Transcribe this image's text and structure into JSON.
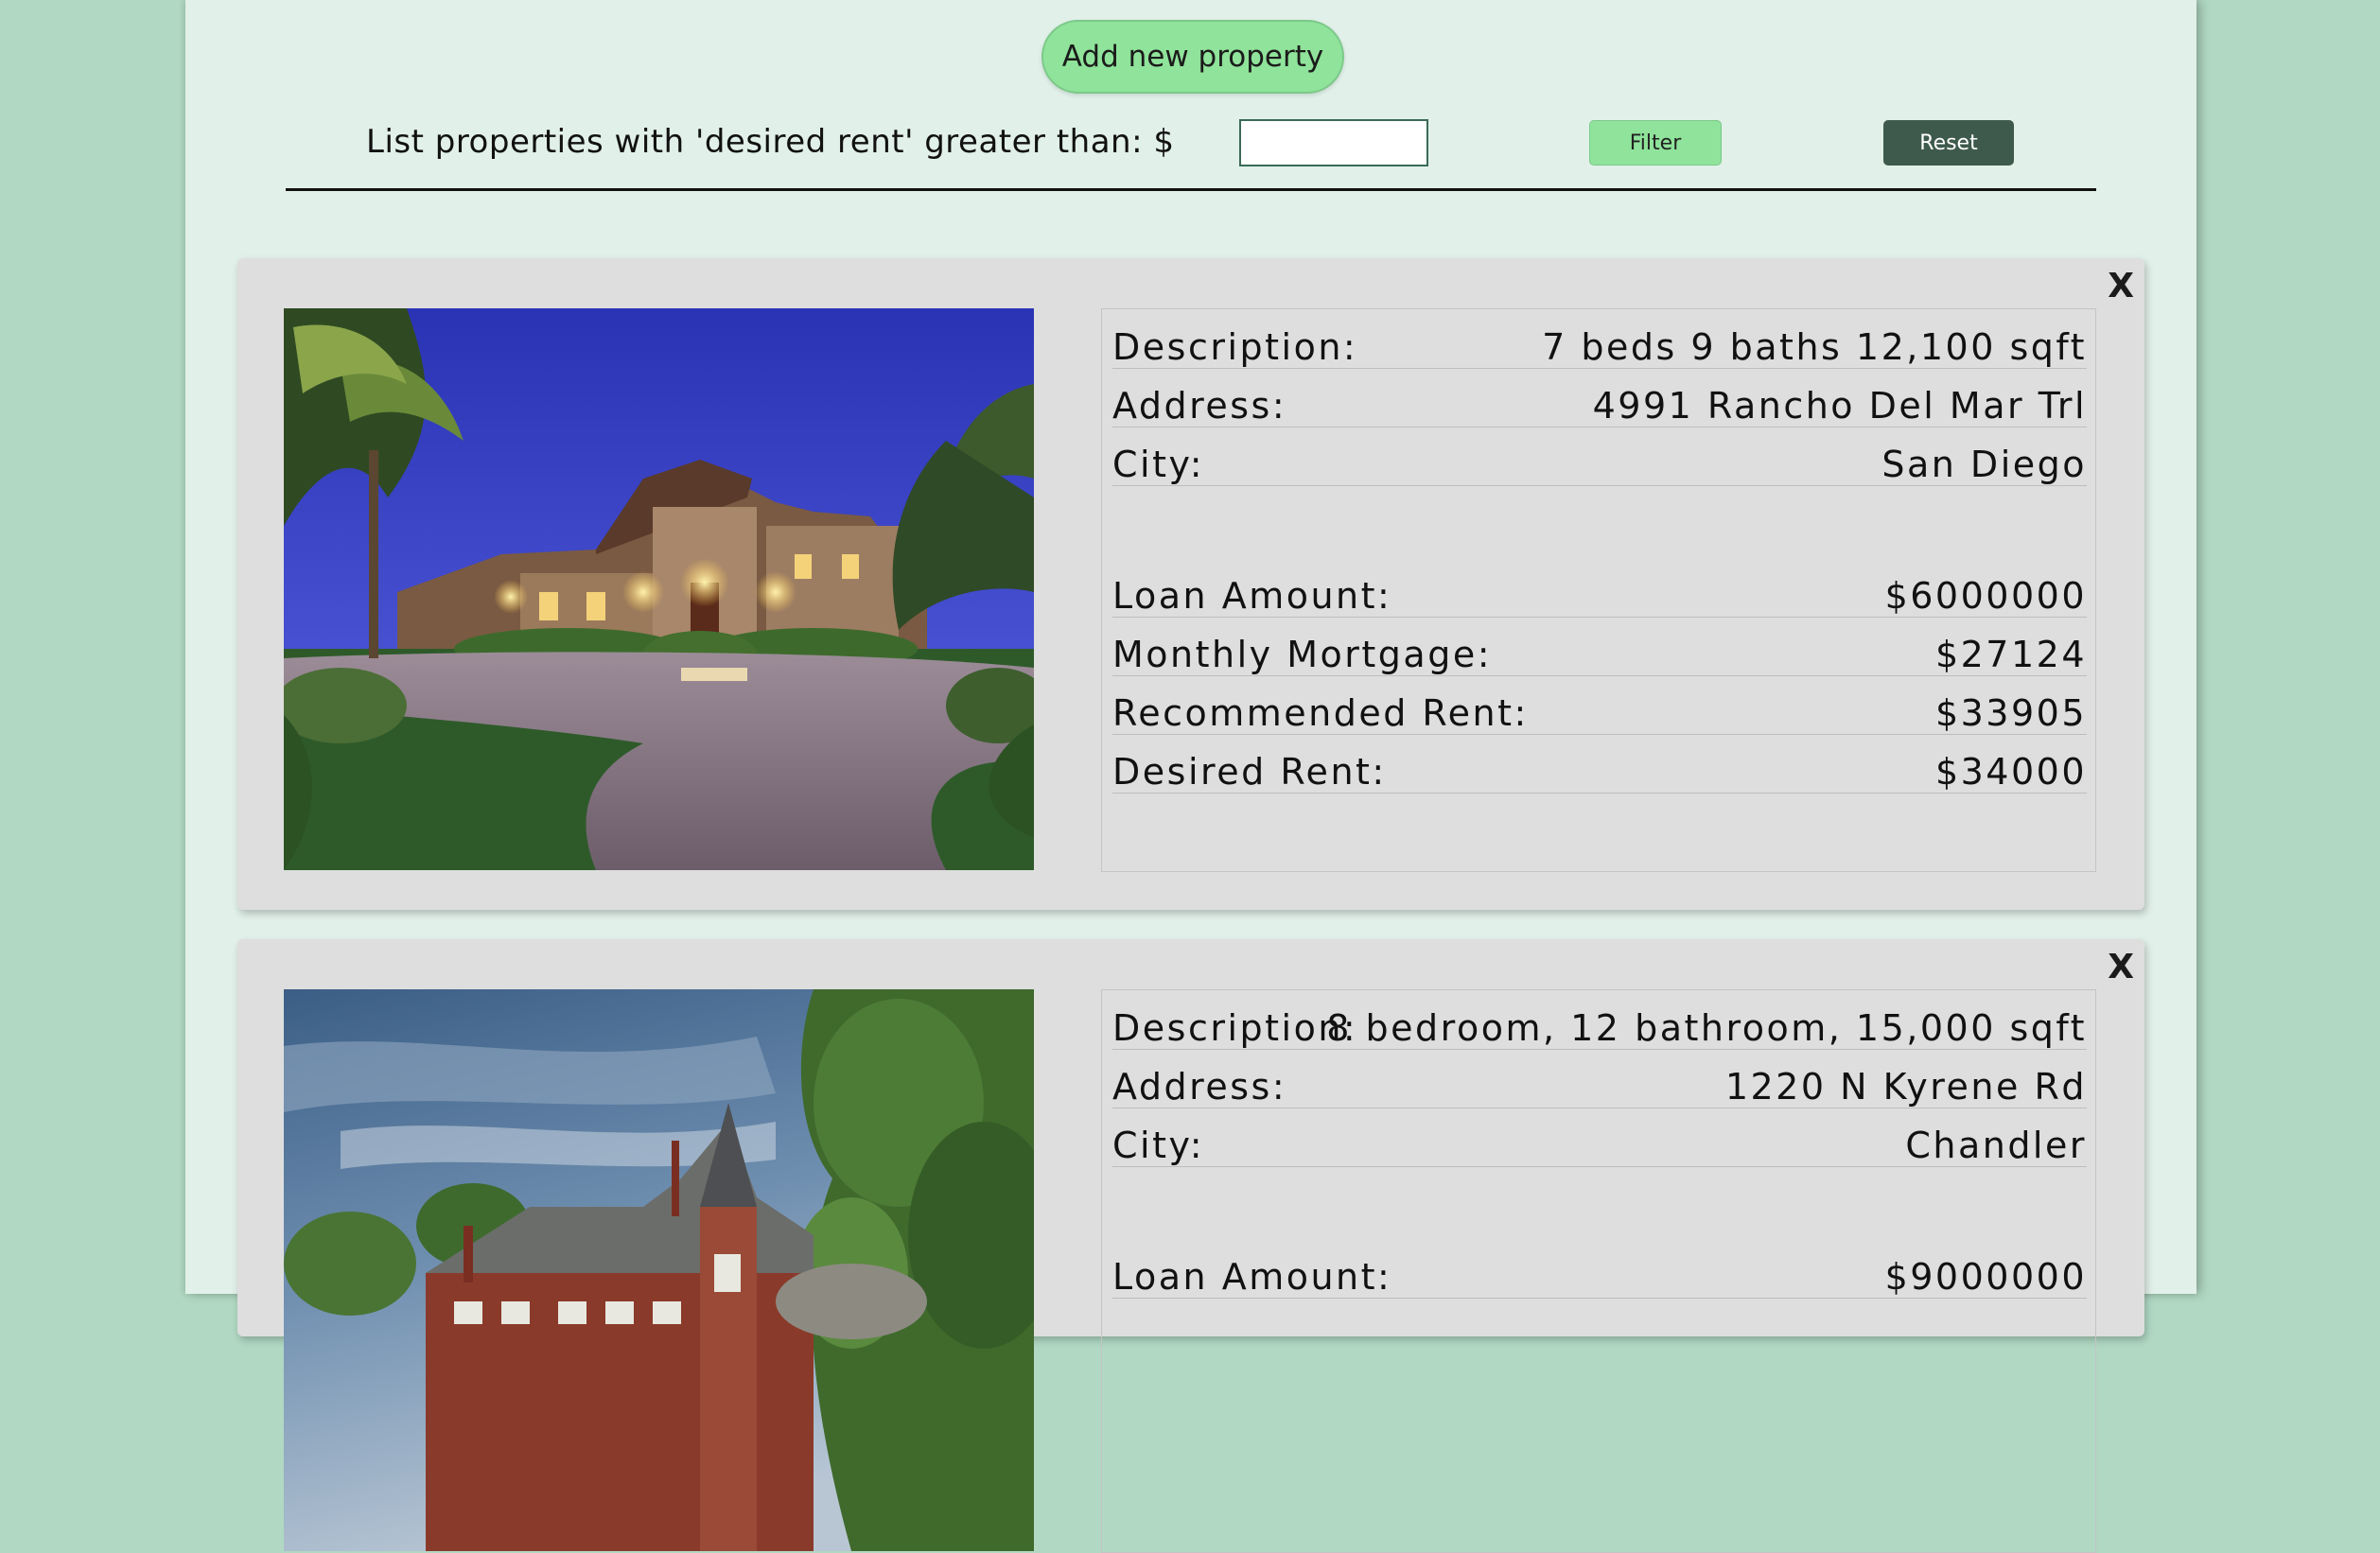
{
  "toolbar": {
    "add_label": "Add new property",
    "filter_label": "List properties with 'desired rent' greater than: $",
    "filter_value": "",
    "filter_button": "Filter",
    "reset_button": "Reset"
  },
  "properties": [
    {
      "close": "X",
      "photo_icon": "house-photo",
      "description_label": "Description:",
      "description": "7 beds 9 baths 12,100 sqft",
      "address_label": "Address:",
      "address": "4991 Rancho Del Mar Trl",
      "city_label": "City:",
      "city": "San Diego",
      "loan_label": "Loan Amount:",
      "loan": "$6000000",
      "mortgage_label": "Monthly Mortgage:",
      "mortgage": "$27124",
      "recommended_label": "Recommended Rent:",
      "recommended": "$33905",
      "desired_label": "Desired Rent:",
      "desired": "$34000"
    },
    {
      "close": "X",
      "photo_icon": "mansion-photo",
      "description_label": "Description:",
      "description": "8 bedroom, 12 bathroom, 15,000 sqft",
      "address_label": "Address:",
      "address": "1220 N Kyrene Rd",
      "city_label": "City:",
      "city": "Chandler",
      "loan_label": "Loan Amount:",
      "loan": "$9000000"
    }
  ],
  "colors": {
    "background": "#b0d8c2",
    "page": "#e1f0e9",
    "accent_button": "#8fe39a",
    "reset_button": "#3e5a4d",
    "card": "#dedede"
  }
}
